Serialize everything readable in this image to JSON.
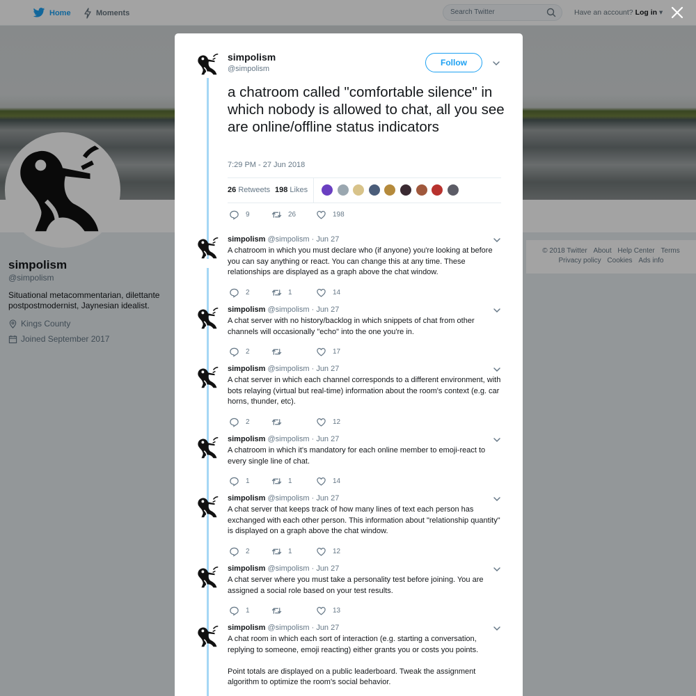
{
  "nav": {
    "home_label": "Home",
    "moments_label": "Moments",
    "search_placeholder": "Search Twitter",
    "account_prompt": "Have an account?",
    "login_label": "Log in"
  },
  "colors": {
    "accent": "#1da1f2",
    "thread_line": "#a5d7f5",
    "muted": "#657786"
  },
  "profile": {
    "name": "simpolism",
    "handle": "@simpolism",
    "bio": "Situational metacommentarian, dilettante postpostmodernist, Jaynesian idealist.",
    "location": "Kings County",
    "joined": "Joined September 2017"
  },
  "footer": {
    "links": [
      "© 2018 Twitter",
      "About",
      "Help Center",
      "Terms",
      "Privacy policy",
      "Cookies",
      "Ads info"
    ]
  },
  "main_tweet": {
    "name": "simpolism",
    "handle": "@simpolism",
    "follow_label": "Follow",
    "text": "a chatroom called \"comfortable silence\" in which nobody is allowed to chat, all you see are online/offline status indicators",
    "timestamp": "7:29 PM - 27 Jun 2018",
    "retweets_count": "26",
    "retweets_label": "Retweets",
    "likes_count": "198",
    "likes_label": "Likes",
    "actions": {
      "replies": "9",
      "retweets": "26",
      "likes": "198"
    },
    "liker_colors": [
      "#6a3fc1",
      "#9aa7b0",
      "#d8c38a",
      "#4b5d7a",
      "#b58a3c",
      "#3a2a32",
      "#a0583c",
      "#b8322e",
      "#5c5c66"
    ]
  },
  "replies": [
    {
      "name": "simpolism",
      "handle": "@simpolism",
      "date": "· Jun 27",
      "text": "A chatroom in which you must declare who (if anyone) you're looking at before you can say anything or react. You can change this at any time. These relationships are displayed as a graph above the chat window.",
      "replies": "2",
      "retweets": "1",
      "likes": "14"
    },
    {
      "name": "simpolism",
      "handle": "@simpolism",
      "date": "· Jun 27",
      "text": "A chat server with no history/backlog in which snippets of chat from other channels will occasionally \"echo\" into the one you're in.",
      "replies": "2",
      "retweets": "",
      "likes": "17"
    },
    {
      "name": "simpolism",
      "handle": "@simpolism",
      "date": "· Jun 27",
      "text": "A chat server in which each channel corresponds to a different environment, with bots relaying (virtual but real-time) information about the room's context (e.g. car horns, thunder, etc).",
      "replies": "2",
      "retweets": "",
      "likes": "12"
    },
    {
      "name": "simpolism",
      "handle": "@simpolism",
      "date": "· Jun 27",
      "text": "A chatroom in which it's mandatory for each online member to emoji-react to every single line of chat.",
      "replies": "1",
      "retweets": "1",
      "likes": "14"
    },
    {
      "name": "simpolism",
      "handle": "@simpolism",
      "date": "· Jun 27",
      "text": "A chat server that keeps track of how many lines of text each person has exchanged with each other person. This information about \"relationship quantity\" is displayed on a graph above the chat window.",
      "replies": "2",
      "retweets": "1",
      "likes": "12"
    },
    {
      "name": "simpolism",
      "handle": "@simpolism",
      "date": "· Jun 27",
      "text": "A chat server where you must take a personality test before joining. You are assigned a social role based on your test results.",
      "replies": "1",
      "retweets": "",
      "likes": "13"
    },
    {
      "name": "simpolism",
      "handle": "@simpolism",
      "date": "· Jun 27",
      "text": "A chat room in which each sort of interaction (e.g. starting a conversation, replying to someone, emoji reacting) either grants you or costs you points.\n\nPoint totals are displayed on a public leaderboard. Tweak the assignment algorithm to optimize the room's social behavior.",
      "replies": "",
      "retweets": "",
      "likes": ""
    }
  ]
}
